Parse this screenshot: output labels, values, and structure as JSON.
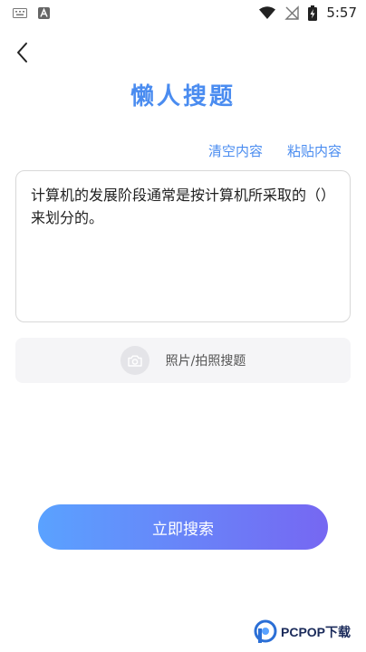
{
  "status_bar": {
    "time": "5:57",
    "icons": [
      "keyboard-icon",
      "android-a-icon",
      "wifi-icon",
      "no-signal-icon",
      "battery-charging-icon"
    ]
  },
  "header": {
    "back_icon": "chevron-left-icon",
    "title": "懒人搜题"
  },
  "actions": {
    "clear_label": "清空内容",
    "paste_label": "粘贴内容"
  },
  "question": {
    "text": "计算机的发展阶段通常是按计算机所采取的（）来划分的。"
  },
  "photo_search": {
    "icon": "camera-icon",
    "label": "照片/拍照搜题"
  },
  "search_button": {
    "label": "立即搜索"
  },
  "watermark": {
    "text": "PCPOP下载"
  },
  "colors": {
    "accent": "#4a8cf0",
    "gradient_start": "#5aa2ff",
    "gradient_end": "#7667f2"
  }
}
